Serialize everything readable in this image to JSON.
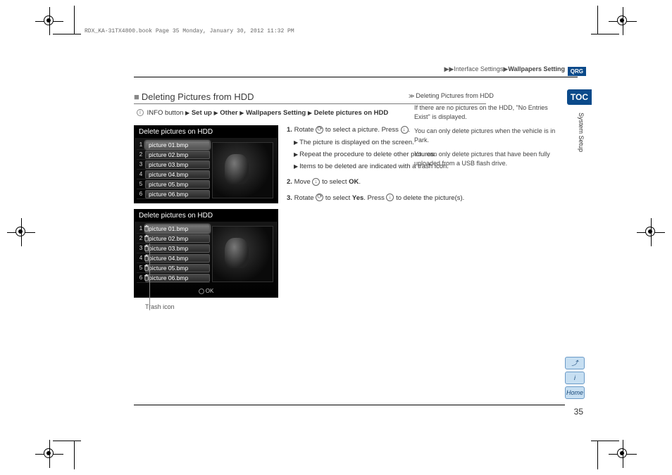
{
  "file_header": "RDX_KA-31TX4800.book  Page 35  Monday, January 30, 2012  11:32 PM",
  "breadcrumb": {
    "arrows": "▶▶",
    "part1": "Interface Settings",
    "sep": "▶",
    "part2": "Wallpapers Setting"
  },
  "tabs": {
    "qrg": "QRG",
    "toc": "TOC",
    "side_label": "System Setup"
  },
  "section": {
    "square": "■",
    "title": "Deleting Pictures from HDD"
  },
  "nav_path": {
    "info_label": "INFO button",
    "sep": "▶",
    "items": [
      "Set up",
      "Other",
      "Wallpapers Setting",
      "Delete pictures on HDD"
    ]
  },
  "device1": {
    "title": "Delete pictures on HDD",
    "rows": [
      {
        "n": "1",
        "name": "picture 01.bmp",
        "sel": true
      },
      {
        "n": "2",
        "name": "picture 02.bmp"
      },
      {
        "n": "3",
        "name": "picture 03.bmp"
      },
      {
        "n": "4",
        "name": "picture 04.bmp"
      },
      {
        "n": "5",
        "name": "picture 05.bmp"
      },
      {
        "n": "6",
        "name": "picture 06.bmp"
      }
    ]
  },
  "device2": {
    "title": "Delete pictures on HDD",
    "rows": [
      {
        "n": "1",
        "name": "picture 01.bmp",
        "sel": true,
        "trash": true
      },
      {
        "n": "2",
        "name": "picture 02.bmp",
        "trash": true
      },
      {
        "n": "3",
        "name": "picture 03.bmp",
        "trash": true
      },
      {
        "n": "4",
        "name": "picture 04.bmp",
        "trash": true
      },
      {
        "n": "5",
        "name": "picture 05.bmp",
        "trash": true
      },
      {
        "n": "6",
        "name": "picture 06.bmp",
        "trash": true
      }
    ],
    "ok": "OK"
  },
  "trash_label": "Trash icon",
  "steps": {
    "s1a": "Rotate",
    "s1b": "to select a picture. Press",
    "s1c": ".",
    "s1_sub1": "The picture is displayed on the screen.",
    "s1_sub2": "Repeat the procedure to delete other pictures.",
    "s1_sub3": "Items to be deleted are indicated with a trash icon.",
    "s2a": "Move",
    "s2b": "to select",
    "s2c": "OK",
    "s2d": ".",
    "s3a": "Rotate",
    "s3b": "to select",
    "s3c": "Yes",
    "s3d": ". Press",
    "s3e": "to delete the picture(s).",
    "n1": "1.",
    "n2": "2.",
    "n3": "3.",
    "tri": "▶"
  },
  "notes": {
    "chev": "≫",
    "head": "Deleting Pictures from HDD",
    "p1": "If there are no pictures on the HDD, \"No Entries Exist\" is displayed.",
    "p2": "You can only delete pictures when the vehicle is in Park.",
    "p3": "You can only delete pictures that have been fully uploaded from a USB flash drive."
  },
  "nav_icons": {
    "prev": "⤴",
    "info": "i",
    "home": "Home"
  },
  "page_number": "35"
}
